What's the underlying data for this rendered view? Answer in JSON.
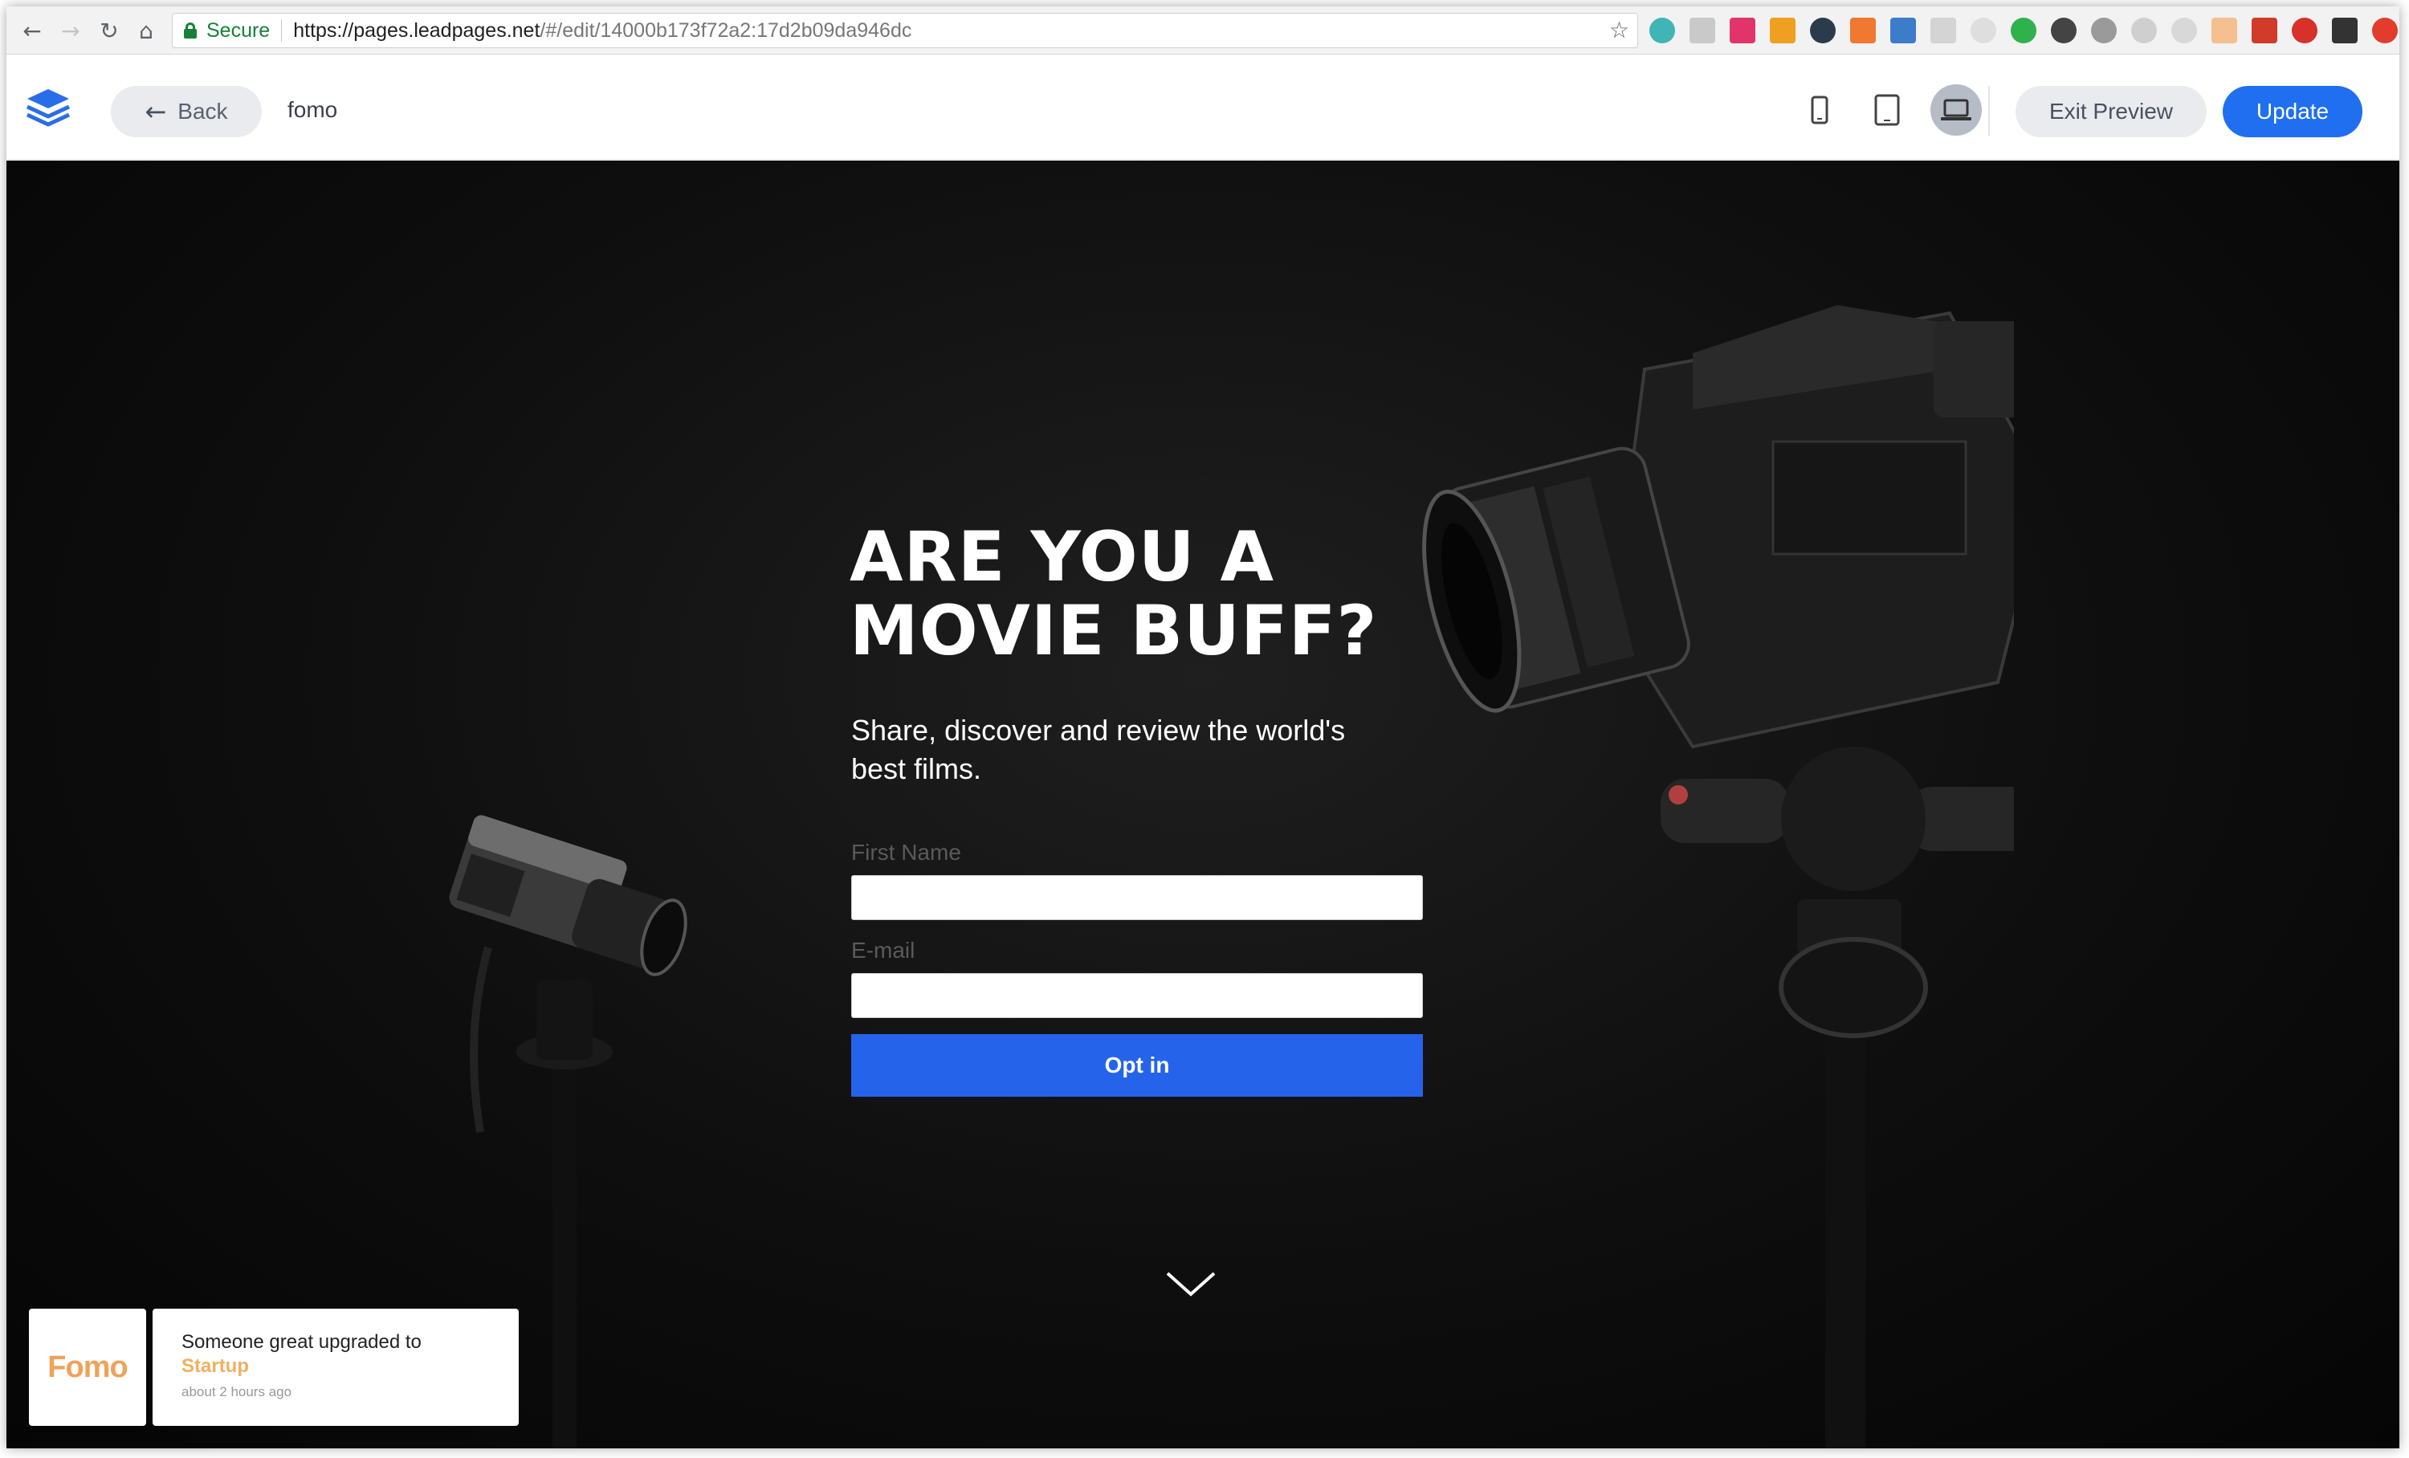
{
  "browser": {
    "secure_label": "Secure",
    "url_host": "https://pages.leadpages.net",
    "url_rest": "/#/edit/14000b173f72a2:17d2b09da946dc",
    "extension_icons": [
      "teal-ext-icon",
      "chat-ext-icon",
      "pink-ext-icon",
      "off-ext-icon",
      "react-ext-icon",
      "orange-ext-icon",
      "calendar-ext-icon",
      "grid-ext-icon",
      "clock-ext-icon",
      "evernote-ext-icon",
      "b-ext-icon",
      "v-ext-icon",
      "shield-ext-icon",
      "rocket-ext-icon",
      "f-ext-icon",
      "red-ext-icon",
      "hand-ext-icon",
      "wave-ext-icon",
      "up-ext-icon"
    ]
  },
  "toolbar": {
    "back_label": "Back",
    "page_name": "fomo",
    "exit_label": "Exit Preview",
    "update_label": "Update"
  },
  "hero": {
    "headline_line1": "ARE YOU A",
    "headline_line2": "MOVIE BUFF?",
    "subtitle": "Share, discover and review the world's best films.",
    "first_name_label": "First Name",
    "email_label": "E-mail",
    "optin_label": "Opt in"
  },
  "toast": {
    "logo_text": "Fomo",
    "message": "Someone great upgraded to",
    "plan": "Startup",
    "time": "about 2 hours ago"
  },
  "colors": {
    "accent": "#1f6ff0",
    "optin": "#2563ea",
    "secure": "#188038",
    "fomo": "#f0a25a"
  }
}
